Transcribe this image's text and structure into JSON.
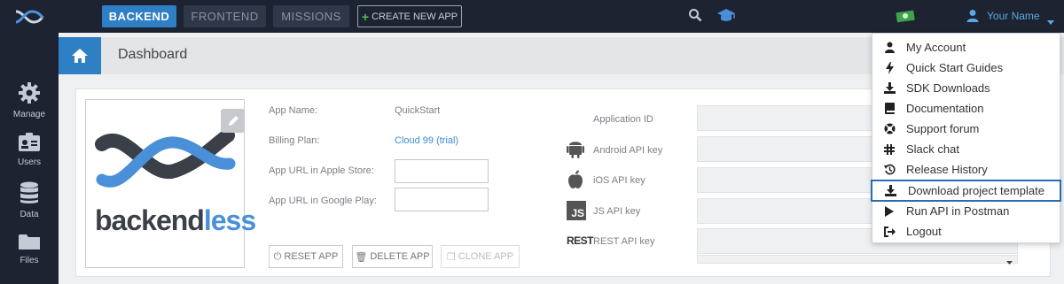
{
  "topbar": {
    "tabs": {
      "backend": "BACKEND",
      "frontend": "FRONTEND",
      "missions": "MISSIONS",
      "create": "CREATE NEW APP"
    },
    "user_name": "Your Name",
    "colors": {
      "bg": "#1d2330",
      "accent": "#2f7fc4",
      "create_plus": "#4cc24c"
    }
  },
  "sidebar": {
    "items": [
      {
        "label": "Manage",
        "icon": "gear-icon"
      },
      {
        "label": "Users",
        "icon": "users-icon"
      },
      {
        "label": "Data",
        "icon": "database-icon"
      },
      {
        "label": "Files",
        "icon": "folder-icon"
      }
    ]
  },
  "dashboard": {
    "title": "Dashboard"
  },
  "app": {
    "logo_text": "backendless",
    "fields": {
      "app_name_label": "App Name:",
      "app_name_value": "QuickStart",
      "billing_label": "Billing Plan:",
      "billing_value": "Cloud 99 (trial)",
      "apple_label": "App URL in Apple Store:",
      "google_label": "App URL in Google Play:"
    },
    "buttons": {
      "reset": "RESET APP",
      "delete": "DELETE APP",
      "clone": "CLONE APP"
    },
    "keys": {
      "application_id": "Application ID",
      "android": "Android API key",
      "ios": "iOS API key",
      "js": "JS API key",
      "rest": "REST API key",
      "js_icon_text": "JS",
      "rest_icon_text": "REST"
    }
  },
  "user_menu": {
    "items": [
      {
        "label": "My Account",
        "icon": "user-icon"
      },
      {
        "label": "Quick Start Guides",
        "icon": "bolt-icon"
      },
      {
        "label": "SDK Downloads",
        "icon": "download-icon"
      },
      {
        "label": "Documentation",
        "icon": "book-icon"
      },
      {
        "label": "Support forum",
        "icon": "lifebuoy-icon"
      },
      {
        "label": "Slack chat",
        "icon": "slack-icon"
      },
      {
        "label": "Release History",
        "icon": "history-icon"
      },
      {
        "label": "Download project template",
        "icon": "download-icon",
        "highlighted": true
      },
      {
        "label": "Run API in Postman",
        "icon": "play-icon"
      },
      {
        "label": "Logout",
        "icon": "logout-icon"
      }
    ]
  }
}
